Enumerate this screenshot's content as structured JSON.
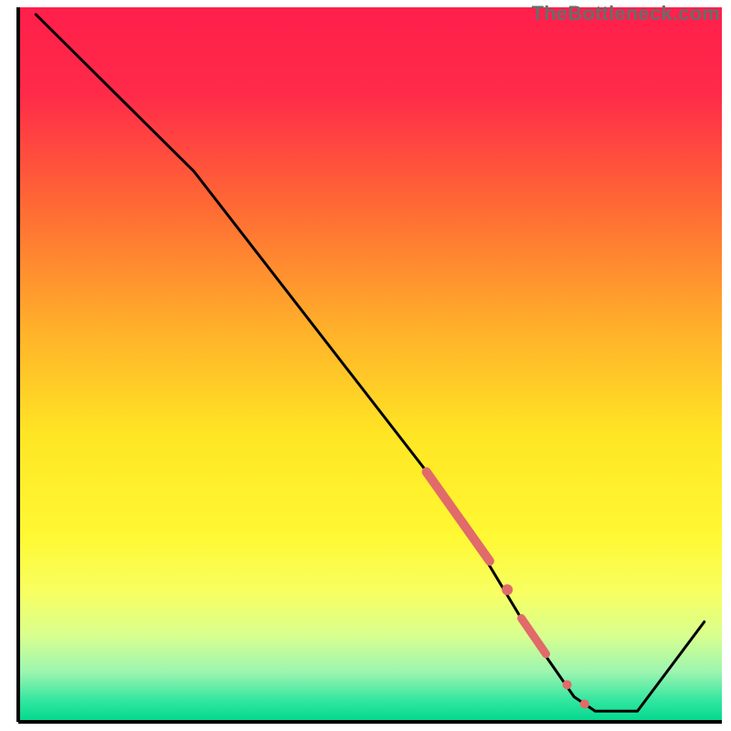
{
  "watermark": "TheBottleneck.com",
  "chart_data": {
    "type": "line",
    "title": "",
    "xlabel": "",
    "ylabel": "",
    "xlim": [
      0,
      100
    ],
    "ylim": [
      0,
      100
    ],
    "gradient": {
      "stops": [
        {
          "offset": 0.0,
          "color": "#ff1f4b"
        },
        {
          "offset": 0.12,
          "color": "#ff2a49"
        },
        {
          "offset": 0.28,
          "color": "#ff6a34"
        },
        {
          "offset": 0.45,
          "color": "#ffb02a"
        },
        {
          "offset": 0.6,
          "color": "#ffe624"
        },
        {
          "offset": 0.74,
          "color": "#fff833"
        },
        {
          "offset": 0.82,
          "color": "#f7ff62"
        },
        {
          "offset": 0.88,
          "color": "#d8ff8f"
        },
        {
          "offset": 0.93,
          "color": "#9cf5b0"
        },
        {
          "offset": 0.97,
          "color": "#33e6a0"
        },
        {
          "offset": 1.0,
          "color": "#00d88d"
        }
      ]
    },
    "series": [
      {
        "name": "bottleneck-curve",
        "values": [
          {
            "x": 2.5,
            "y": 99.0
          },
          {
            "x": 25.0,
            "y": 77.0
          },
          {
            "x": 62.0,
            "y": 30.0
          },
          {
            "x": 73.0,
            "y": 12.0
          },
          {
            "x": 79.0,
            "y": 3.5
          },
          {
            "x": 82.0,
            "y": 1.5
          },
          {
            "x": 88.0,
            "y": 1.5
          },
          {
            "x": 97.5,
            "y": 14.0
          }
        ]
      }
    ],
    "markers": [
      {
        "name": "highlight-segment",
        "type": "thick-line",
        "color": "#e16a6a",
        "from": {
          "x": 58.0,
          "y": 35.0
        },
        "to": {
          "x": 67.0,
          "y": 22.5
        },
        "width": 10
      },
      {
        "name": "dot-1",
        "type": "dot",
        "color": "#e16a6a",
        "x": 69.5,
        "y": 18.5,
        "r": 6
      },
      {
        "name": "highlight-segment-2",
        "type": "thick-line",
        "color": "#e16a6a",
        "from": {
          "x": 71.5,
          "y": 14.5
        },
        "to": {
          "x": 75.0,
          "y": 9.5
        },
        "width": 9
      },
      {
        "name": "dot-2",
        "type": "dot",
        "color": "#e16a6a",
        "x": 78.0,
        "y": 5.2,
        "r": 5
      },
      {
        "name": "dot-3",
        "type": "dot",
        "color": "#e16a6a",
        "x": 80.5,
        "y": 2.5,
        "r": 5
      }
    ],
    "axes": {
      "color": "#000000",
      "left_x": 2.5,
      "bottom_y": 0.0,
      "right_x": 97.5,
      "top_y": 99.0
    }
  }
}
